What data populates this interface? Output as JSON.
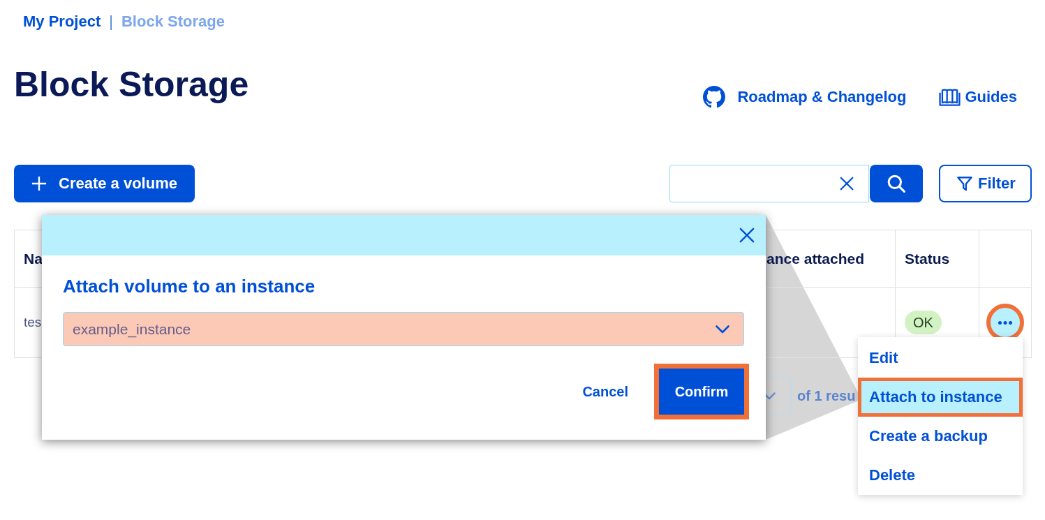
{
  "breadcrumb": {
    "separator": "|",
    "items": [
      {
        "label": "My Project",
        "current": false
      },
      {
        "label": "Block Storage",
        "current": true
      }
    ]
  },
  "page": {
    "title": "Block Storage",
    "links": [
      {
        "kind": "repo",
        "label": "Roadmap & Changelog"
      },
      {
        "kind": "guides",
        "label": "Guides"
      }
    ]
  },
  "toolbar": {
    "create_button": "Create a volume",
    "filter_button": "Filter"
  },
  "table": {
    "columns": [
      "Na",
      "ance attached",
      "Status"
    ],
    "rows": [
      {
        "column_1": "tes",
        "status": "OK",
        "menu_button": {
          "highlighted": true
        }
      }
    ]
  },
  "pagination": {
    "summary": "of 1 resu"
  },
  "row_menu": {
    "items": [
      {
        "label": "Edit",
        "highlighted": false
      },
      {
        "label": "Attach to instance",
        "highlighted": true
      },
      {
        "label": "Create a backup",
        "highlighted": false
      },
      {
        "label": "Delete",
        "highlighted": false
      }
    ]
  },
  "dialog": {
    "title": "Attach volume to an instance",
    "select": {
      "value": "example_instance"
    },
    "buttons": [
      {
        "kind": "text",
        "label": "Cancel",
        "highlighted": false
      },
      {
        "kind": "primary",
        "label": "Confirm",
        "highlighted": true
      }
    ]
  }
}
